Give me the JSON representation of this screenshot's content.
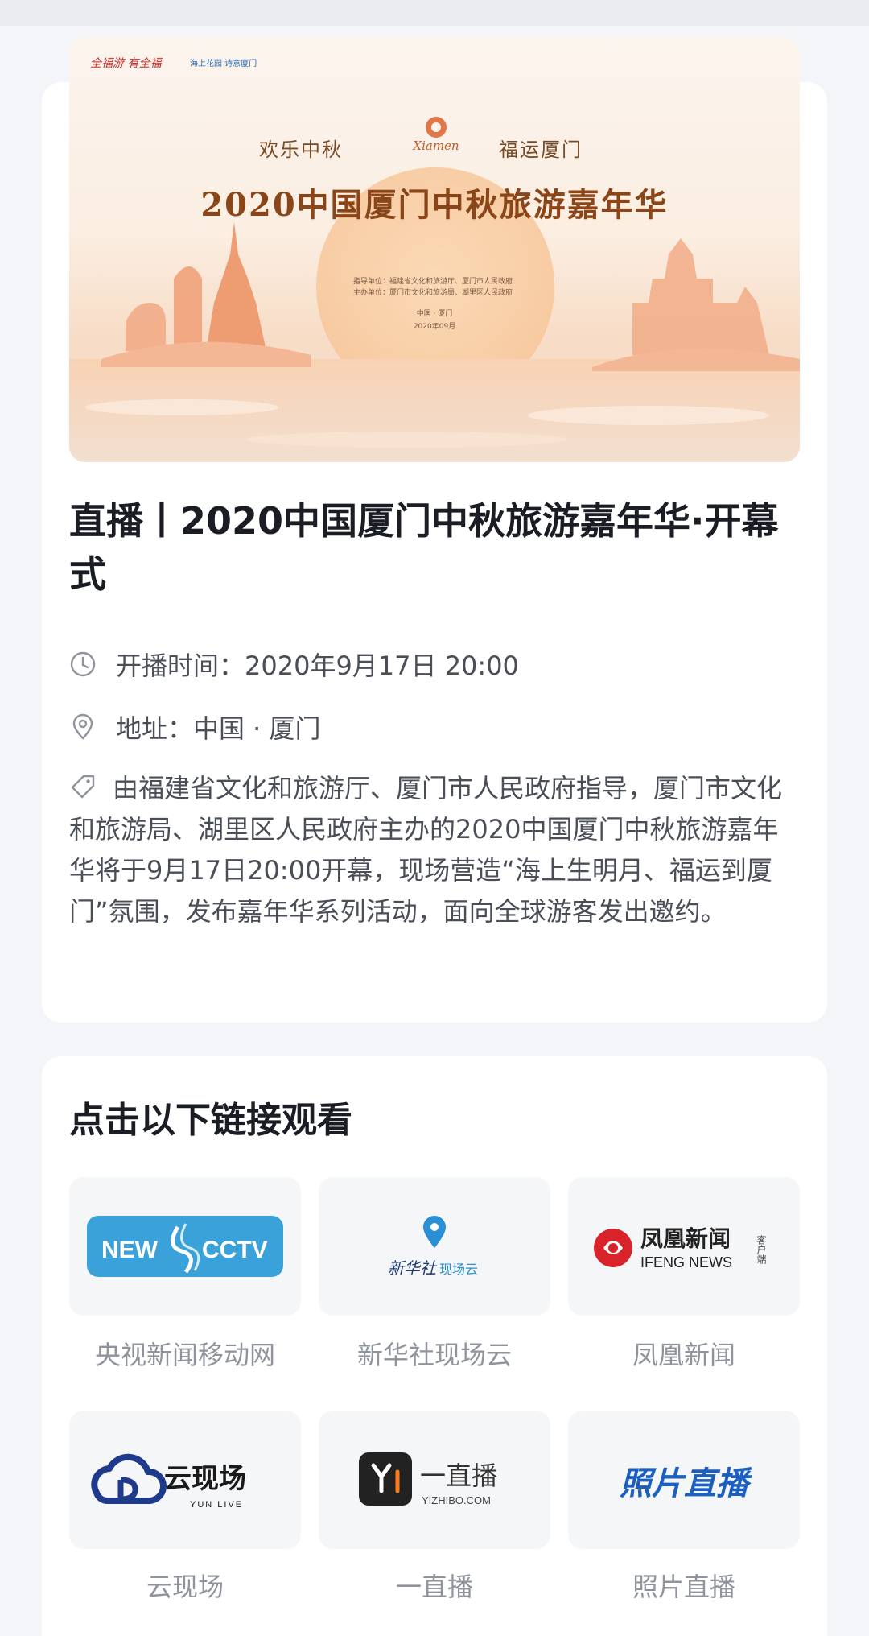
{
  "banner": {
    "logo_left": "全福游 有全福",
    "logo_right": "海上花园 诗意厦门",
    "slogan_left": "欢乐中秋",
    "slogan_right": "福运厦门",
    "emblem_text": "Xiamen",
    "headline": "2020中国厦门中秋旅游嘉年华",
    "guide_line": "指导单位：福建省文化和旅游厅、厦门市人民政府",
    "host_line": "主办单位：厦门市文化和旅游局、湖里区人民政府",
    "place": "中国 · 厦门",
    "date": "2020年09月"
  },
  "event": {
    "title": "直播丨2020中国厦门中秋旅游嘉年华·开幕式",
    "start_time": "开播时间：2020年9月17日 20:00",
    "address": "地址：中国 · 厦门",
    "description": "由福建省文化和旅游厅、厦门市人民政府指导，厦门市文化和旅游局、湖里区人民政府主办的2020中国厦门中秋旅游嘉年华将于9月17日20:00开幕，现场营造“海上生明月、福运到厦门”氛围，发布嘉年华系列活动，面向全球游客发出邀约。"
  },
  "links": {
    "section_title": "点击以下链接观看",
    "items": [
      {
        "label": "央视新闻移动网",
        "logo_text_1": "NEW",
        "logo_text_2": "CCTV",
        "icon": "cctv-news-logo"
      },
      {
        "label": "新华社现场云",
        "logo_text_1": "新华社",
        "logo_text_2": "现场云",
        "icon": "xinhua-xianchangyun-logo"
      },
      {
        "label": "凤凰新闻",
        "logo_text_1": "凤凰新闻",
        "logo_text_2": "IFENG NEWS",
        "logo_text_3": "客户端",
        "icon": "ifeng-news-logo"
      },
      {
        "label": "云现场",
        "logo_text_1": "云现场",
        "logo_text_2": "YUN LIVE",
        "icon": "yun-live-logo"
      },
      {
        "label": "一直播",
        "logo_text_1": "一直播",
        "logo_text_2": "YIZHIBO.COM",
        "icon": "yizhibo-logo"
      },
      {
        "label": "照片直播",
        "logo_text_1": "照片直播",
        "icon": "photo-live-logo"
      }
    ]
  },
  "colors": {
    "title": "#1a1d24",
    "body_text": "#4a4e57",
    "muted_label": "#8f939b",
    "cctv_blue": "#3aa2d8",
    "ifeng_red": "#d8232a",
    "yun_navy": "#1f3a8a",
    "photo_blue": "#1b5fc1"
  }
}
